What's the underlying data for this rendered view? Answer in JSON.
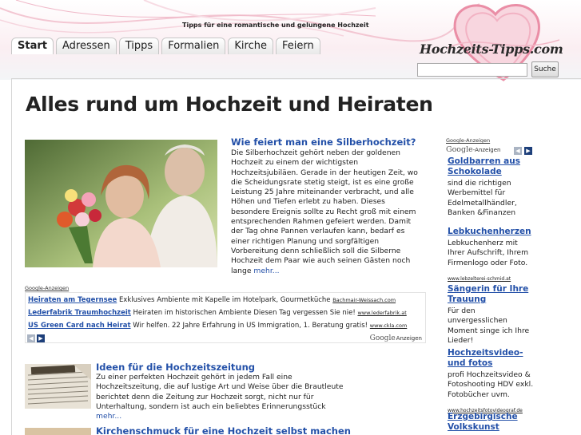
{
  "header": {
    "tagline": "Tipps für eine romantische und gelungene Hochzeit",
    "logo": "Hochzeits-Tipps.com",
    "search_button": "Suche",
    "search_value": ""
  },
  "nav": {
    "tabs": [
      "Start",
      "Adressen",
      "Tipps",
      "Formalien",
      "Kirche",
      "Feiern"
    ]
  },
  "main": {
    "title": "Alles rund um Hochzeit und Heiraten",
    "feature": {
      "title": "Wie feiert man eine Silberhochzeit?",
      "text": "Die Silberhochzeit gehört neben der goldenen Hochzeit zu einem der wichtigsten Hochzeitsjubiläen. Gerade in der heutigen Zeit, wo die Scheidungsrate stetig steigt, ist es eine große Leistung 25 Jahre miteinander verbracht, und alle Höhen und Tiefen erlebt zu haben. Dieses besondere Ereignis sollte zu Recht groß mit einem entsprechenden Rahmen gefeiert werden. Damit der Tag ohne Pannen verlaufen kann, bedarf es einer richtigen Planung und sorgfältigen Vorbereitung denn schließlich soll die Silberne Hochzeit dem Paar wie auch seinen Gästen noch lange",
      "more": "mehr..."
    },
    "ads": {
      "label": "Google-Anzeigen",
      "footer": "Anzeigen",
      "google": "Google",
      "items": [
        {
          "title": "Heiraten am Tegernsee",
          "text": "Exklusives Ambiente mit Kapelle im Hotelpark, Gourmetküche",
          "url": "Bachmair-Weissach.com"
        },
        {
          "title": "Lederfabrik Traumhochzeit",
          "text": "Heiraten im historischen Ambiente Diesen Tag vergessen Sie nie!",
          "url": "www.lederfabrik.at"
        },
        {
          "title": "US Green Card nach Heirat",
          "text": "Wir helfen. 22 Jahre Erfahrung in US Immigration, 1. Beratung gratis!",
          "url": "www.ckla.com"
        }
      ]
    },
    "articles": [
      {
        "title": "Ideen für die Hochzeitszeitung",
        "text": "Zu einer perfekten Hochzeit gehört in jedem Fall eine Hochzeitszeitung, die auf lustige Art und Weise über die Brautleute berichtet denn die Zeitung zur Hochzeit sorgt, nicht nur für Unterhaltung, sondern ist auch ein beliebtes Erinnerungsstück",
        "more": "mehr..."
      },
      {
        "title": "Kirchenschmuck für eine Hochzeit selbst machen",
        "text": "",
        "more": ""
      }
    ]
  },
  "sidebar": {
    "label": "Google-Anzeigen",
    "google": "Google",
    "anzeigen": "-Anzeigen",
    "items": [
      {
        "title": "Goldbarren aus Schokolade",
        "text": "sind die richtigen Werbemittel für Edelmetallhändler, Banken &Finanzen",
        "url": ""
      },
      {
        "title": "Lebkuchenherzen",
        "text": "Lebkuchenherz mit Ihrer Aufschrift, Ihrem Firmenlogo oder Foto.",
        "url": "www.lebzelterei-schmid.at"
      },
      {
        "title": "Sängerin für Ihre Trauung",
        "text": "Für den unvergesslichen Moment singe ich Ihre Lieder!",
        "url": ""
      },
      {
        "title": "Hochzeitsvideo- und fotos",
        "text": "profi Hochzeitsvideo & Fotoshooting HDV exkl. Fotobücher uvm.",
        "url": "www.hochzeitsfotovideograf.de"
      },
      {
        "title": "Erzgebirgische Volkskunst",
        "text": "",
        "url": ""
      }
    ]
  },
  "colors": {
    "link": "#2350a8",
    "accent_pink": "#e8708f"
  }
}
